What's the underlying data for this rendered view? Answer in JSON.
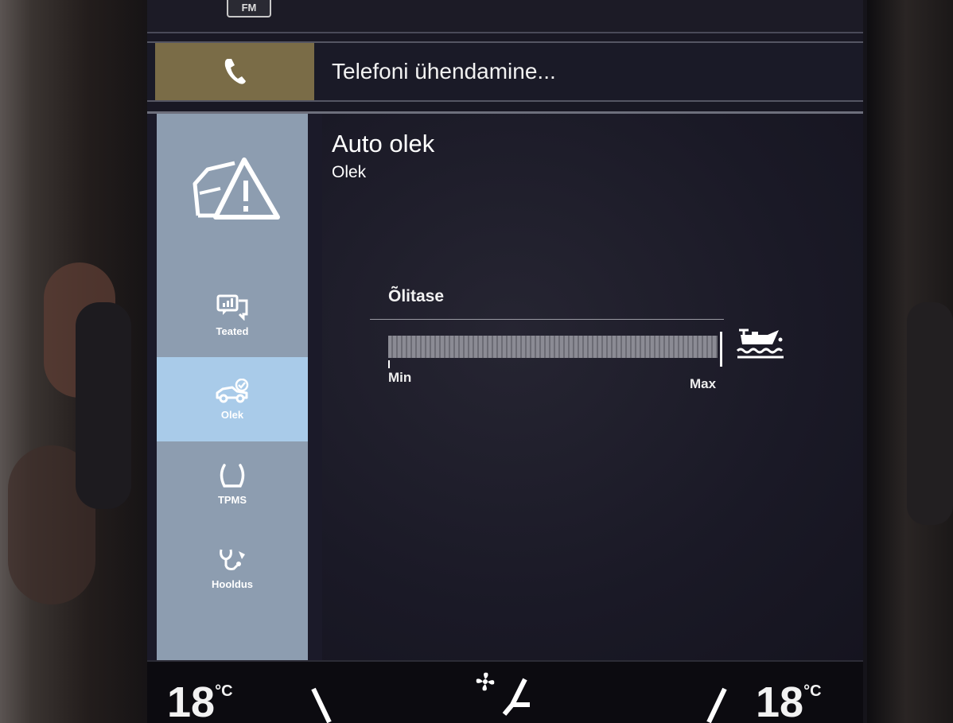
{
  "top_strip": {
    "source_badge": "FM"
  },
  "phone_bar": {
    "status": "Telefoni ühendamine...",
    "icon": "phone-icon"
  },
  "page": {
    "title": "Auto olek",
    "subtitle": "Olek"
  },
  "sidebar": {
    "header_icon": "car-warning-icon",
    "items": [
      {
        "label": "Teated",
        "icon": "messages-icon",
        "active": false
      },
      {
        "label": "Olek",
        "icon": "car-check-icon",
        "active": true
      },
      {
        "label": "TPMS",
        "icon": "tire-pressure-icon",
        "active": false
      },
      {
        "label": "Hooldus",
        "icon": "service-wrench-icon",
        "active": false
      }
    ]
  },
  "oil_level": {
    "label": "Õlitase",
    "min_label": "Min",
    "max_label": "Max",
    "level_fraction": 1.0,
    "icon": "oil-can-icon"
  },
  "climate": {
    "left_temp": "18",
    "right_temp": "18",
    "unit": "°C",
    "fan_icon": "fan-icon",
    "seat_icon": "seat-heat-icon"
  },
  "colors": {
    "phone_tile": "#7a6c47",
    "sidebar": "#8d9db0",
    "sidebar_active": "#a9cbe9",
    "content_bg": "#1b1a29"
  }
}
